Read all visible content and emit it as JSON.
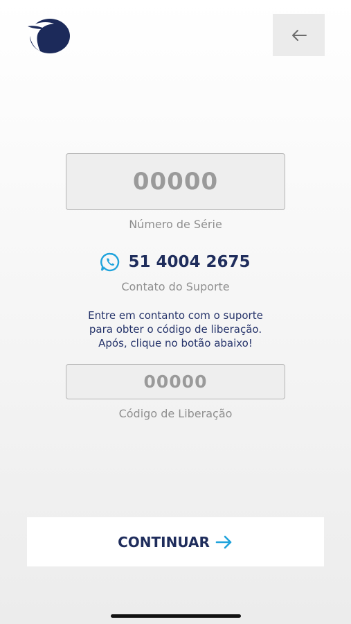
{
  "header": {
    "back_icon": "arrow-left-icon",
    "logo_icon": "eagle-logo-icon"
  },
  "serial": {
    "value": "00000",
    "label": "Número de Série"
  },
  "support": {
    "icon": "whatsapp-icon",
    "icon_color": "#1fa3dc",
    "phone": "51 4004 2675",
    "label": "Contato do Suporte"
  },
  "instructions": [
    "Entre em contanto com o suporte",
    "para obter o código de liberação.",
    "Após, clique no botão abaixo!"
  ],
  "release": {
    "placeholder": "00000",
    "label": "Código de Liberação"
  },
  "continue_button": {
    "label": "CONTINUAR",
    "arrow_icon": "arrow-right-icon",
    "arrow_color": "#1fa3dc"
  },
  "colors": {
    "primary": "#1f2d5c",
    "accent": "#1fa3dc",
    "muted": "#8f8f8f"
  }
}
